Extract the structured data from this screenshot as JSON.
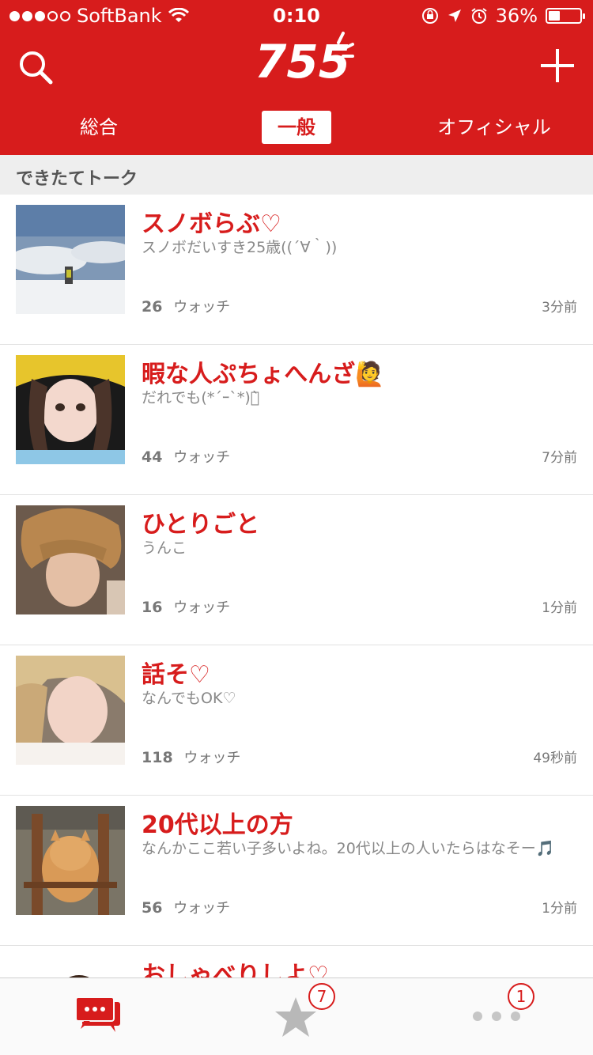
{
  "status_bar": {
    "carrier": "SoftBank",
    "time": "0:10",
    "battery_percent": "36%",
    "battery_level": 0.36
  },
  "header": {
    "logo": "755",
    "tabs": [
      {
        "label": "総合",
        "selected": false
      },
      {
        "label": "一般",
        "selected": true
      },
      {
        "label": "オフィシャル",
        "selected": false
      }
    ]
  },
  "section_title": "できたてトーク",
  "talks": [
    {
      "title": "スノボらぶ♡",
      "description": "スノボだいすき25歳((´∀｀))",
      "watch_count": "26",
      "watch_label": "ウォッチ",
      "time_ago": "3分前"
    },
    {
      "title": "暇な人ぷちょへんざ🙋",
      "description": "だれでも(*´ｰ`*)ง̀",
      "watch_count": "44",
      "watch_label": "ウォッチ",
      "time_ago": "7分前"
    },
    {
      "title": "ひとりごと",
      "description": "うんこ",
      "watch_count": "16",
      "watch_label": "ウォッチ",
      "time_ago": "1分前"
    },
    {
      "title": "話そ♡",
      "description": "なんでもOK♡",
      "watch_count": "118",
      "watch_label": "ウォッチ",
      "time_ago": "49秒前"
    },
    {
      "title": "20代以上の方",
      "description": "なんかここ若い子多いよね。20代以上の人いたらはなそー🎵",
      "watch_count": "56",
      "watch_label": "ウォッチ",
      "time_ago": "1分前"
    },
    {
      "title": "おしゃべりしよ♡",
      "description": "",
      "watch_count": "",
      "watch_label": "",
      "time_ago": ""
    }
  ],
  "tab_bar": {
    "talk_icon": "chat-bubbles-icon",
    "favorites_badge": "7",
    "more_badge": "1"
  },
  "colors": {
    "brand": "#d71c1c",
    "section_bg": "#eeeeee",
    "meta_text": "#777777"
  }
}
